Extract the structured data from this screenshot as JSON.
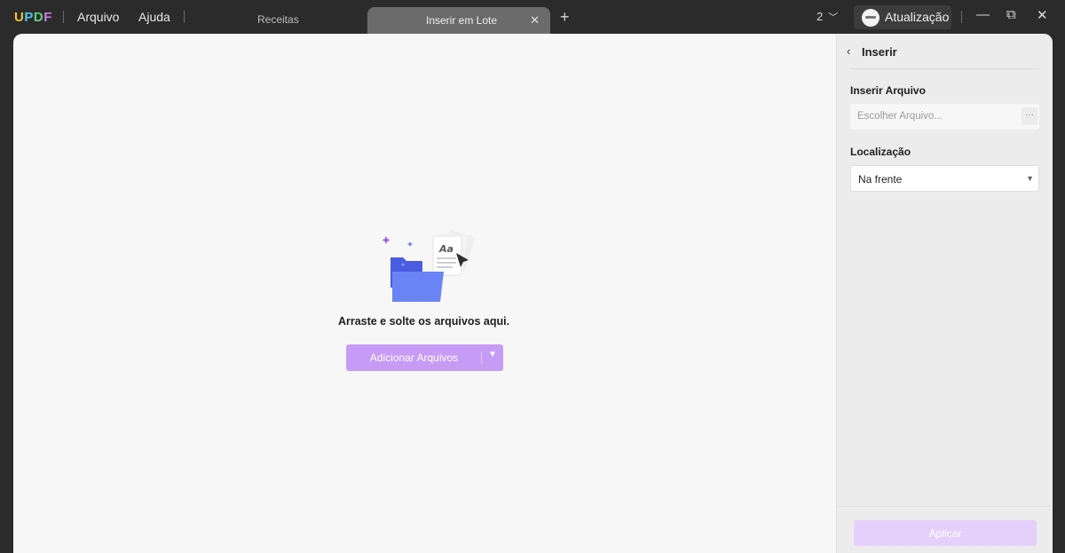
{
  "app": {
    "logo": {
      "u": "U",
      "p": "P",
      "d": "D",
      "f": "F"
    }
  },
  "menu": {
    "file": "Arquivo",
    "help": "Ajuda"
  },
  "tabs": [
    {
      "label": "Receitas",
      "active": false
    },
    {
      "label": "Inserir em Lote",
      "active": true
    }
  ],
  "titlebar": {
    "close_tab_icon": "close-icon",
    "add_tab_icon": "plus-icon",
    "page_count": "2",
    "update_label": "Atualização",
    "colors": {
      "bar": "#2b2b2b",
      "active_tab": "#6b6b6b"
    }
  },
  "drop_area": {
    "text": "Arraste e solte os arquivos aqui.",
    "add_button": "Adicionar Arquivos",
    "accent": "#c69bf6"
  },
  "panel": {
    "title": "Inserir",
    "insert_file_label": "Inserir Arquivo",
    "file_placeholder": "Escolher Arquivo...",
    "browse_label": "···",
    "location_label": "Localização",
    "location_value": "Na frente",
    "apply_label": "Aplicar"
  }
}
